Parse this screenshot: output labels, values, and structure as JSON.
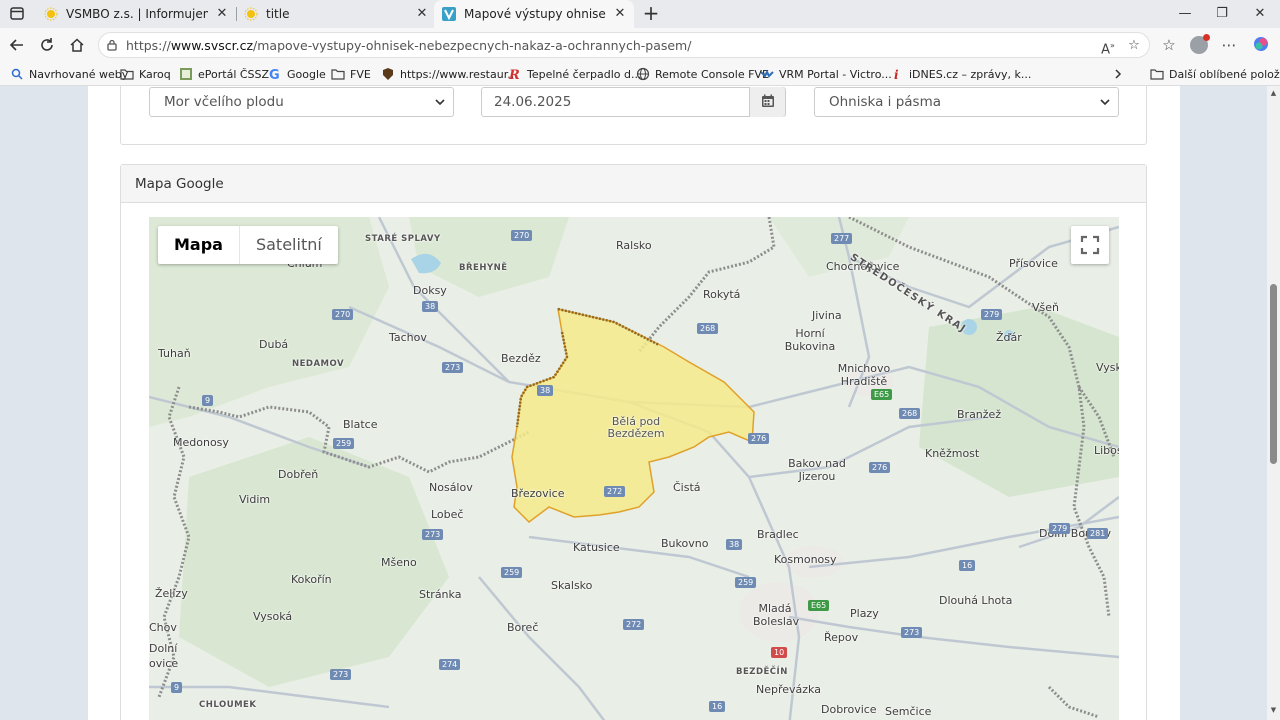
{
  "tabs": [
    {
      "title": "VSMBO z.s. | Informujeme",
      "active": false
    },
    {
      "title": "title",
      "active": false
    },
    {
      "title": "Mapové výstupy ohnisek nákaz v",
      "active": true
    }
  ],
  "address_bar": {
    "prefix": "https://",
    "domain": "www.svscr.cz",
    "path": "/mapove-vystupy-ohnisek-nebezpecnych-nakaz-a-ochrannych-pasem/"
  },
  "bookmarks": [
    {
      "label": "Navrhované weby",
      "icon": "search-icon"
    },
    {
      "label": "Karoq",
      "icon": "folder-icon"
    },
    {
      "label": "ePortál ČSSZ",
      "icon": "site-icon"
    },
    {
      "label": "Google",
      "icon": "google-icon"
    },
    {
      "label": "FVE",
      "icon": "folder-icon"
    },
    {
      "label": "https://www.restaur...",
      "icon": "site-icon"
    },
    {
      "label": "Tepelné čerpadlo d...",
      "icon": "site-icon"
    },
    {
      "label": "Remote Console FVE",
      "icon": "globe-icon"
    },
    {
      "label": "VRM Portal - Victro...",
      "icon": "site-icon"
    },
    {
      "label": "iDNES.cz – zprávy, k...",
      "icon": "site-icon"
    }
  ],
  "bookmarks_more": "Další oblíbené položky",
  "filters": {
    "disease": "Mor včelího plodu",
    "date": "24.06.2025",
    "layer": "Ohniska i pásma"
  },
  "map_panel": {
    "title": "Mapa Google",
    "map_type_map": "Mapa",
    "map_type_satellite": "Satelitní"
  },
  "map_labels": {
    "places": [
      "Ralsko",
      "Chocnějovice",
      "Přísovice",
      "Rokytá",
      "Doksy",
      "Jivina",
      "Všeň",
      "Tachov",
      "Horní Bukovina",
      "Žďár",
      "Tuhaň",
      "Dubá",
      "Bezděz",
      "Mnichovo Hradiště",
      "Blatce",
      "Bělá pod Bezdězem",
      "Branžež",
      "Medonosy",
      "Kněžmost",
      "Dobřeň",
      "Bakov nad Jizerou",
      "Nosálov",
      "Čistá",
      "Vidim",
      "Březovice",
      "Lobeč",
      "Bradlec",
      "Katusice",
      "Bukovno",
      "Kosmonosy",
      "Mšeno",
      "Kokořín",
      "Skalsko",
      "Želízy",
      "Stránka",
      "Vysoká",
      "Mladá Boleslav",
      "Plazy",
      "Dlouhá Lhota",
      "Boreč",
      "Řepov",
      "Nepřevázka",
      "Dobrovice",
      "Semčice",
      "Libos",
      "Dolní Bousov",
      "Vysk",
      "Chlum",
      "Chov",
      "Dolní",
      "ovice"
    ],
    "small_caps": [
      "STARÉ SPLAVY",
      "BŘEHYNĚ",
      "NEDAMOV",
      "BEZDĚČÍN",
      "CHLOUMEK"
    ],
    "region": "STŘEDOČESKÝ KRAJ",
    "road_shields": [
      "270",
      "38",
      "273",
      "277",
      "268",
      "279",
      "259",
      "276",
      "272",
      "E65",
      "281",
      "16",
      "274",
      "10",
      "9"
    ]
  },
  "colors": {
    "zone_fill": "#f5ea8a",
    "zone_border": "#e0a12a",
    "border_line": "#8a8a8a",
    "road": "#b8c2cc"
  }
}
